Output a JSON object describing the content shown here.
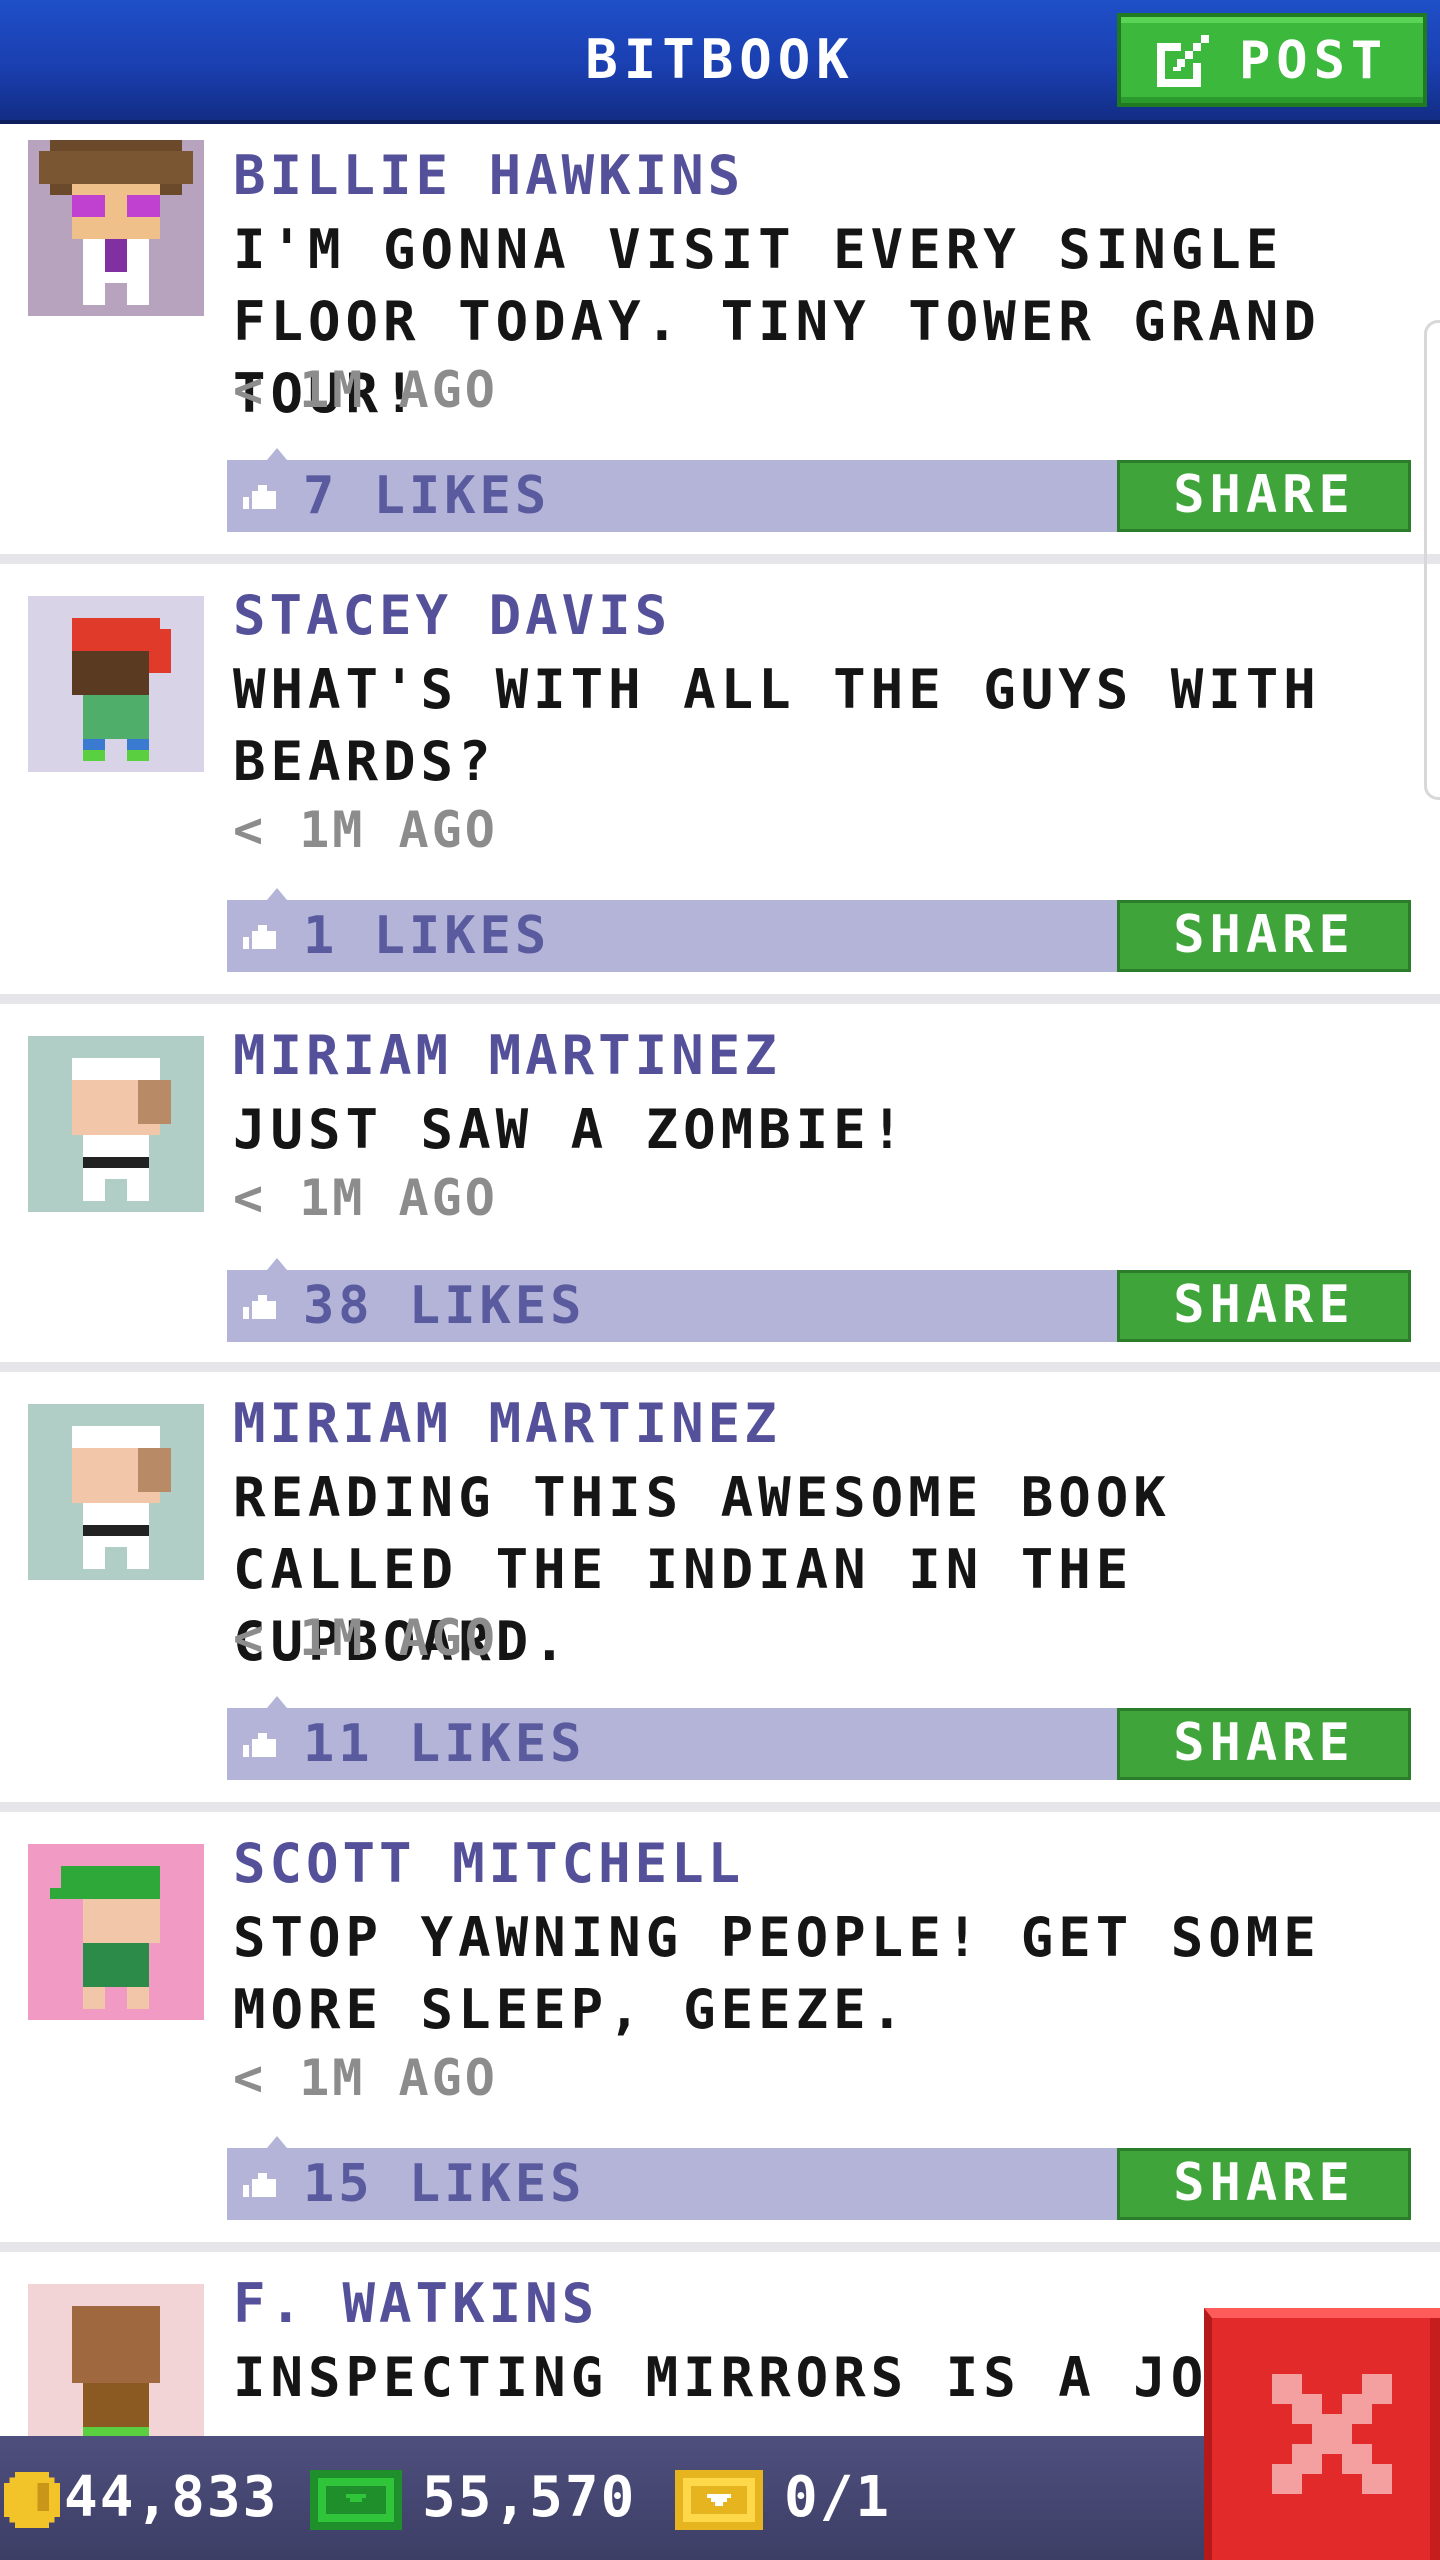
{
  "header": {
    "title": "BITBOOK",
    "post_label": "POST"
  },
  "posts": [
    {
      "author": "BILLIE HAWKINS",
      "message": "I'M GONNA VISIT EVERY SINGLE FLOOR TODAY. TINY TOWER GRAND TOUR!",
      "time": "< 1M AGO",
      "likes": "7 LIKES",
      "share_label": "SHARE",
      "avatar_bg": "#b8a3be"
    },
    {
      "author": "STACEY DAVIS",
      "message": "WHAT'S WITH ALL THE GUYS WITH BEARDS?",
      "time": "< 1M AGO",
      "likes": "1 LIKES",
      "share_label": "SHARE",
      "avatar_bg": "#d8d3e6"
    },
    {
      "author": "MIRIAM MARTINEZ",
      "message": "JUST SAW A ZOMBIE!",
      "time": "< 1M AGO",
      "likes": "38 LIKES",
      "share_label": "SHARE",
      "avatar_bg": "#b0cec6"
    },
    {
      "author": "MIRIAM MARTINEZ",
      "message": "READING THIS AWESOME BOOK CALLED THE INDIAN IN THE CUPBOARD.",
      "time": "< 1M AGO",
      "likes": "11 LIKES",
      "share_label": "SHARE",
      "avatar_bg": "#b0cec6"
    },
    {
      "author": "SCOTT MITCHELL",
      "message": "STOP YAWNING PEOPLE! GET SOME MORE SLEEP, GEEZE.",
      "time": "< 1M AGO",
      "likes": "15 LIKES",
      "share_label": "SHARE",
      "avatar_bg": "#f09ac4"
    },
    {
      "author": "F. WATKINS",
      "message": "INSPECTING MIRRORS IS A JOB I",
      "time": "",
      "likes": "",
      "share_label": "",
      "avatar_bg": "#f2d4d6"
    }
  ],
  "footer": {
    "coins": "44,833",
    "bux": "55,570",
    "tickets": "0/1"
  },
  "icons": {
    "post": "edit-icon",
    "like": "thumbs-up-icon",
    "coin": "coin-icon",
    "bux": "bux-icon",
    "ticket": "golden-ticket-icon",
    "close": "close-icon"
  },
  "colors": {
    "header_blue": "#1a3fb0",
    "post_green": "#3cb83c",
    "author_purple": "#54519a",
    "like_bar": "#b3b4d8",
    "share_green": "#3fa53a",
    "footer": "#3d3e66",
    "close_red": "#e22a2a"
  }
}
